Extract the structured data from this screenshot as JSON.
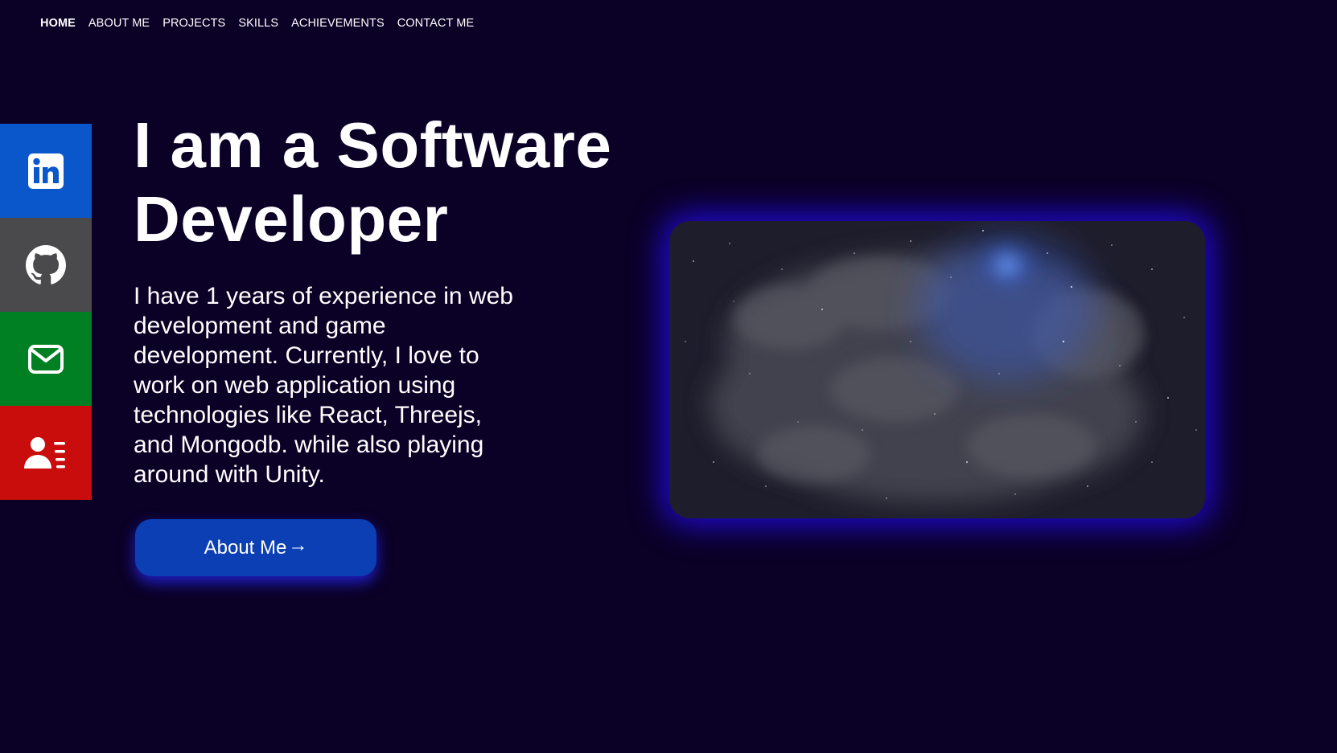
{
  "nav": {
    "items": [
      {
        "label": "HOME",
        "active": true
      },
      {
        "label": "ABOUT ME",
        "active": false
      },
      {
        "label": "PROJECTS",
        "active": false
      },
      {
        "label": "SKILLS",
        "active": false
      },
      {
        "label": "ACHIEVEMENTS",
        "active": false
      },
      {
        "label": "CONTACT ME",
        "active": false
      }
    ]
  },
  "social": [
    {
      "name": "linkedin-icon",
      "color": "#0a57cc"
    },
    {
      "name": "github-icon",
      "color": "#4a4a4d"
    },
    {
      "name": "email-icon",
      "color": "#008022"
    },
    {
      "name": "resume-icon",
      "color": "#c90c0c"
    }
  ],
  "hero": {
    "title_line1": "I am a Software",
    "title_line2": "Developer",
    "bio": "I have 1 years of experience in web development and game development. Currently, I love to work on web application using technologies like React, Threejs, and Mongodb. while also playing around with Unity.",
    "button_label": "About Me",
    "button_arrow": "→"
  },
  "colors": {
    "background": "#0b0026",
    "button": "#0b3fb3",
    "glow": "#220ae6"
  }
}
